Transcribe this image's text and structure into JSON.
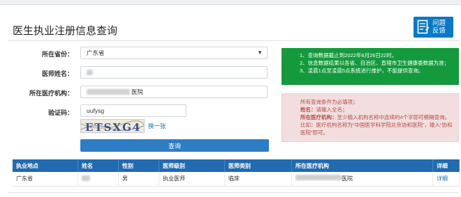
{
  "page": {
    "title": "医生执业注册信息查询",
    "feedback_line1": "问题",
    "feedback_line2": "反馈"
  },
  "form": {
    "province_label": "所在省份：",
    "province_value": "广东省",
    "name_label": "医师姓名：",
    "institution_label": "所在医疗机构：",
    "institution_suffix": "医院",
    "captcha_label": "验证码：",
    "captcha_value": "uufysg",
    "captcha_image_text": "ETSXG4",
    "refresh_link": "换一张",
    "query_button": "查询"
  },
  "notice_green": {
    "line1": "1、查询数据截止到2022年6月26日22时。",
    "line2": "2、信息数据结果以各省、自治区、直辖市卫生健康委数据为准；",
    "line3": "3、凌晨1点至凌晨5点系统进行维护，不能提供查询。"
  },
  "notice_red": {
    "line1": "所有查询条件为必填项；",
    "name_key": "姓名：",
    "name_text": "请输入全名；",
    "inst_key": "所在医疗机构：",
    "inst_text": "至少输入机构名称中连续的4个字即可模糊查询。比如：医疗机构名称为“中国医学科学院北京协和医院”，输入“协和医院”即可。"
  },
  "table": {
    "headers": [
      "执业地点",
      "姓名",
      "性别",
      "医师级别",
      "医师类别",
      "所在医疗机构",
      "详细"
    ],
    "row": {
      "location": "广东省",
      "gender": "男",
      "level": "执业医师",
      "category": "临床",
      "institution_suffix": "医院",
      "detail": "详细"
    }
  },
  "colors": {
    "accent_blue": "#2e7cc4",
    "table_header": "#236aae",
    "notice_green": "#149a3c",
    "notice_red_bg": "#f2dede",
    "notice_red_text": "#b94a48"
  }
}
